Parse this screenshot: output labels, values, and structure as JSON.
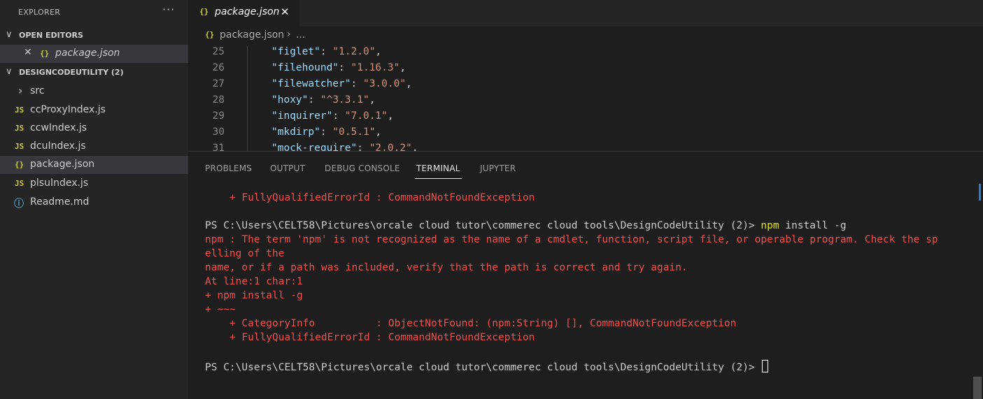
{
  "sidebar": {
    "title": "EXPLORER",
    "more": "···",
    "open_editors": {
      "label": "OPEN EDITORS",
      "chevron": "∨",
      "items": [
        {
          "close": "✕",
          "icon": "{}",
          "name": "package.json"
        }
      ]
    },
    "folder": {
      "label": "DESIGNCODEUTILITY (2)",
      "chevron": "∨",
      "items": [
        {
          "chevron": "›",
          "name": "src"
        },
        {
          "icon": "JS",
          "name": "ccProxyIndex.js"
        },
        {
          "icon": "JS",
          "name": "ccwIndex.js"
        },
        {
          "icon": "JS",
          "name": "dcuIndex.js"
        },
        {
          "icon": "{}",
          "name": "package.json"
        },
        {
          "icon": "JS",
          "name": "plsuIndex.js"
        },
        {
          "icon": "ⓘ",
          "name": "Readme.md"
        }
      ]
    }
  },
  "editor": {
    "tab": {
      "icon": "{}",
      "label": "package.json",
      "close": "✕"
    },
    "breadcrumb": {
      "icon": "{}",
      "file": "package.json",
      "sep": "›",
      "rest": "..."
    },
    "lines": [
      {
        "n": "25",
        "key": "\"figlet\"",
        "val": "\"1.2.0\""
      },
      {
        "n": "26",
        "key": "\"filehound\"",
        "val": "\"1.16.3\""
      },
      {
        "n": "27",
        "key": "\"filewatcher\"",
        "val": "\"3.0.0\""
      },
      {
        "n": "28",
        "key": "\"hoxy\"",
        "val": "\"^3.3.1\""
      },
      {
        "n": "29",
        "key": "\"inquirer\"",
        "val": "\"7.0.1\""
      },
      {
        "n": "30",
        "key": "\"mkdirp\"",
        "val": "\"0.5.1\""
      },
      {
        "n": "31",
        "key": "\"mock-require\"",
        "val": "\"2.0.2\""
      }
    ]
  },
  "panel": {
    "tabs": [
      "PROBLEMS",
      "OUTPUT",
      "DEBUG CONSOLE",
      "TERMINAL",
      "JUPYTER"
    ],
    "terminal": {
      "line1": "    + FullyQualifiedErrorId : CommandNotFoundException",
      "prompt": "PS C:\\Users\\CELT58\\Pictures\\orcale cloud tutor\\commerec cloud tools\\DesignCodeUtility (2)> ",
      "cmd": "npm",
      "cmd_args": " install -g",
      "err1": "npm : The term 'npm' is not recognized as the name of a cmdlet, function, script file, or operable program. Check the sp",
      "err2": "elling of the",
      "err3": "name, or if a path was included, verify that the path is correct and try again.",
      "err4": "At line:1 char:1",
      "err5": "+ npm install -g",
      "err6": "+ ~~~",
      "err7": "    + CategoryInfo          : ObjectNotFound: (npm:String) [], CommandNotFoundException",
      "err8": "    + FullyQualifiedErrorId : CommandNotFoundException",
      "prompt2": "PS C:\\Users\\CELT58\\Pictures\\orcale cloud tutor\\commerec cloud tools\\DesignCodeUtility (2)> "
    }
  },
  "colors": {
    "sidebar_bg": "#252526",
    "editor_bg": "#1e1e1e",
    "json_icon": "#cbcb41",
    "terminal_error": "#f14c4c",
    "terminal_cmd": "#e5e510"
  }
}
